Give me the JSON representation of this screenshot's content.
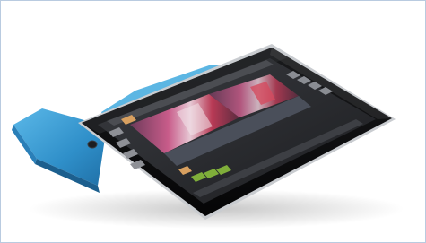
{
  "image": {
    "subject": "tablet-on-blue-folding-cover",
    "colors": {
      "background": "#ffffff",
      "frame_border": "#b9cbe0",
      "cover": "#3aa0d6",
      "device_body": "#0c0c0d",
      "bezel_edge": "#c9ccd0",
      "screen": "#2b2d31",
      "accent_thumb": "#d8a060",
      "accent_green": "#7fae3a"
    }
  }
}
